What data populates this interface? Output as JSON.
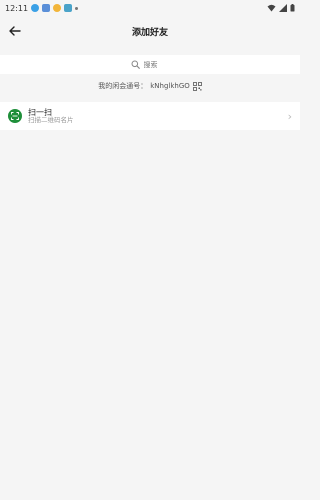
{
  "status_bar": {
    "time": "12:11"
  },
  "header": {
    "title": "添加好友"
  },
  "search": {
    "placeholder": "搜索"
  },
  "account": {
    "label": "我的闲会通号：",
    "id": "kNhglkhGO"
  },
  "scan": {
    "title": "扫一扫",
    "subtitle": "扫描二维码名片"
  },
  "colors": {
    "background": "#f5f5f5",
    "accent_green": "#1f8f3a"
  }
}
